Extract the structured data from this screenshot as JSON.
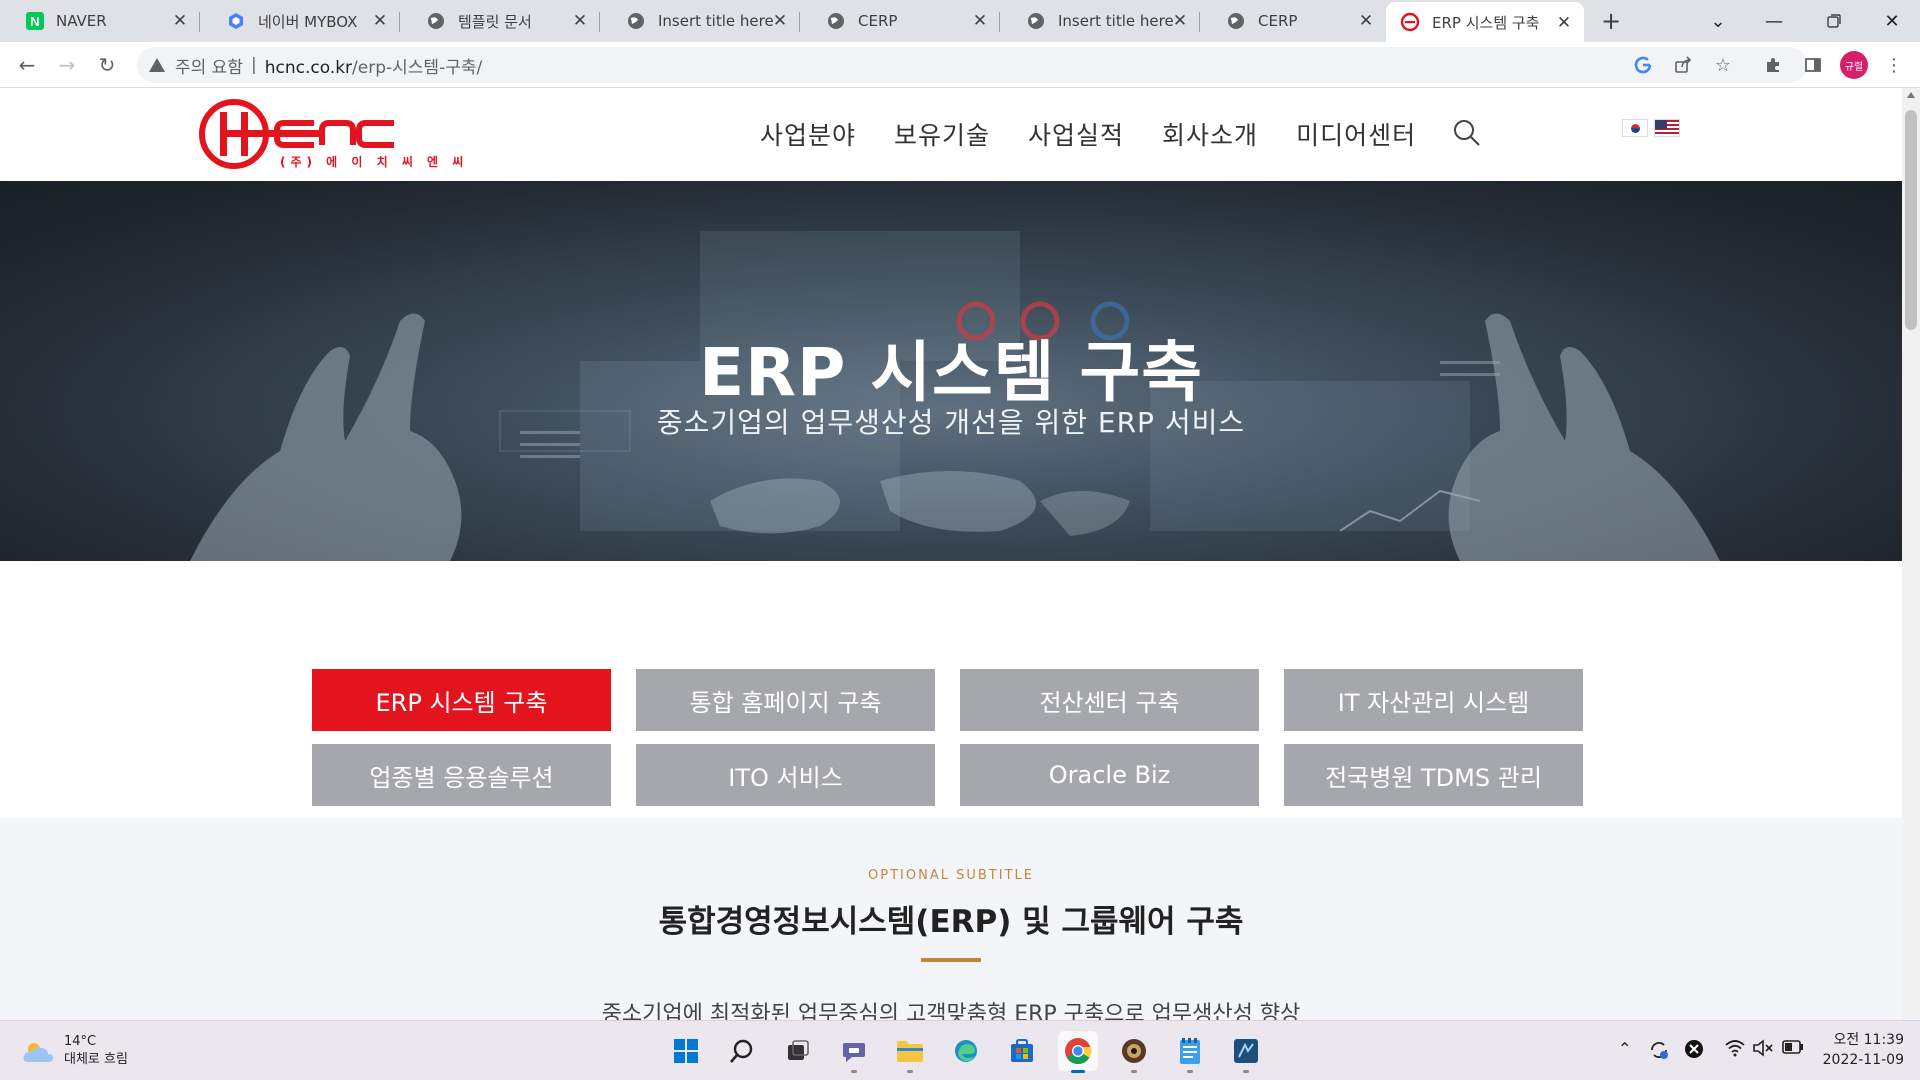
{
  "browser": {
    "tabs": [
      {
        "title": "NAVER",
        "favicon": "naver-icon",
        "favicon_text": "N"
      },
      {
        "title": "네이버 MYBOX",
        "favicon": "mybox-icon"
      },
      {
        "title": "템플릿 문서",
        "favicon": "globe-icon"
      },
      {
        "title": "Insert title here",
        "favicon": "globe-icon"
      },
      {
        "title": "CERP",
        "favicon": "globe-icon"
      },
      {
        "title": "Insert title here",
        "favicon": "globe-icon"
      },
      {
        "title": "CERP",
        "favicon": "globe-icon"
      },
      {
        "title": "ERP 시스템 구축",
        "favicon": "hcnc-icon",
        "active": true
      }
    ],
    "omnibox": {
      "security_warning": "주의 요함",
      "separator": "|",
      "url_host": "hcnc.co.kr",
      "url_path": "/erp-시스템-구축/"
    },
    "profile_initials": "규렬"
  },
  "site": {
    "logo_subtext": "(주) 에 이 치 씨 엔 씨",
    "nav": [
      "사업분야",
      "보유기술",
      "사업실적",
      "회사소개",
      "미디어센터"
    ],
    "languages": [
      "korean-flag",
      "us-flag"
    ],
    "hero": {
      "title": "ERP 시스템 구축",
      "subtitle": "중소기업의 업무생산성 개선을 위한 ERP 서비스"
    },
    "service_tabs": [
      {
        "label": "ERP 시스템 구축",
        "active": true
      },
      {
        "label": "통합 홈페이지 구축",
        "active": false
      },
      {
        "label": "전산센터 구축",
        "active": false
      },
      {
        "label": "IT 자산관리 시스템",
        "active": false
      },
      {
        "label": "업종별 응용솔루션",
        "active": false
      },
      {
        "label": "ITO 서비스",
        "active": false
      },
      {
        "label": "Oracle Biz",
        "active": false
      },
      {
        "label": "전국병원 TDMS 관리",
        "active": false
      }
    ],
    "section": {
      "eyebrow": "OPTIONAL SUBTITLE",
      "title": "통합경영정보시스템(ERP) 및 그룹웨어 구축",
      "description": "중소기업에 최적화된 업무중심의 고객맞춤형 ERP 구축으로 업무생산성 향상"
    },
    "colors": {
      "brand_red": "#e3141e",
      "inactive_tab": "#a6a6ad",
      "accent_gold": "#c0873f"
    }
  },
  "taskbar": {
    "weather": {
      "temp": "14°C",
      "condition": "대체로 흐림"
    },
    "clock": {
      "time": "오전 11:39",
      "date": "2022-11-09"
    }
  }
}
